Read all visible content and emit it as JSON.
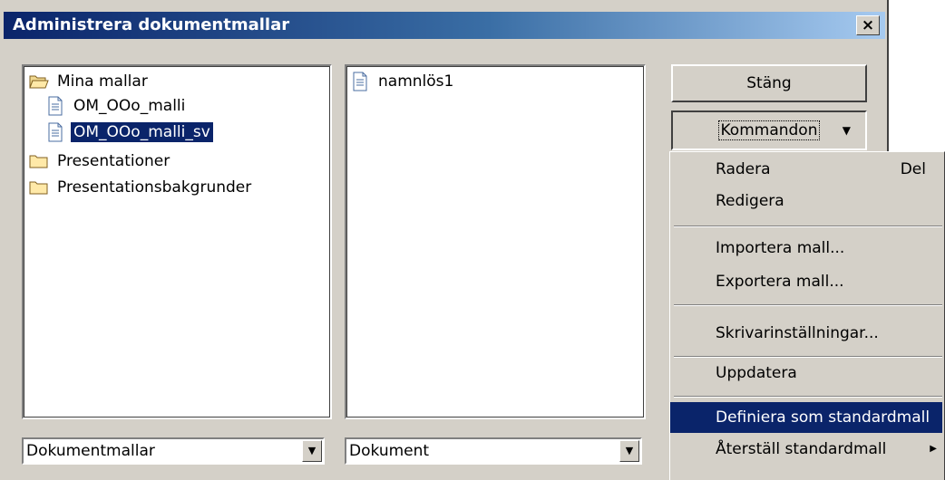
{
  "dialog": {
    "title": "Administrera dokumentmallar",
    "close_glyph": "×"
  },
  "left_tree": {
    "items": [
      {
        "label": "Mina mallar",
        "icon": "folder-open-icon"
      },
      {
        "label": "OM_OOo_malli",
        "icon": "document-icon"
      },
      {
        "label": "OM_OOo_malli_sv",
        "icon": "document-icon",
        "selected": true
      },
      {
        "label": "Presentationer",
        "icon": "folder-icon"
      },
      {
        "label": "Presentationsbakgrunder",
        "icon": "folder-icon"
      }
    ]
  },
  "mid_list": {
    "items": [
      {
        "label": "namnlös1",
        "icon": "document-icon"
      }
    ]
  },
  "buttons": {
    "close": "Stäng",
    "commands": "Kommandon"
  },
  "combos": {
    "left_value": "Dokumentmallar",
    "mid_value": "Dokument"
  },
  "menu": {
    "radera": "Radera",
    "radera_shortcut": "Del",
    "redigera": "Redigera",
    "importera": "Importera mall...",
    "exportera": "Exportera mall...",
    "skrivare": "Skrivarinställningar...",
    "uppdatera": "Uppdatera",
    "definiera": "Definiera som standardmall",
    "aterstall": "Återställ standardmall"
  },
  "colors": {
    "title_gradient_start": "#0a246a",
    "selection": "#0a246a",
    "face": "#d4d0c8"
  }
}
